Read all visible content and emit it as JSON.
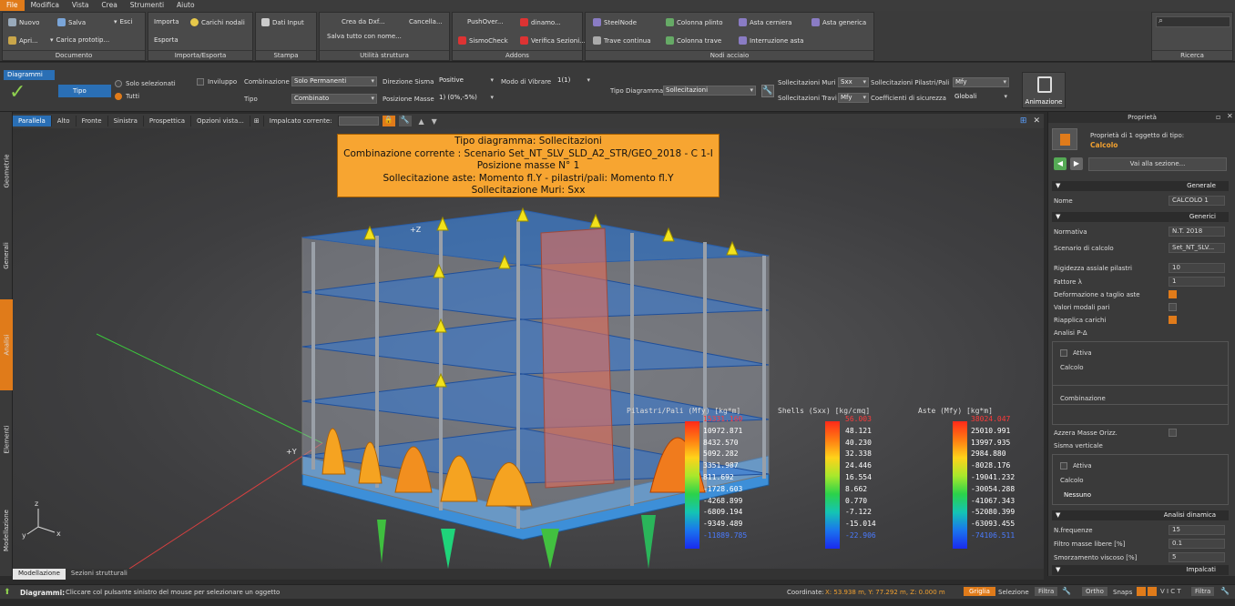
{
  "menu": [
    "File",
    "Modifica",
    "Vista",
    "Crea",
    "Strumenti",
    "Aiuto"
  ],
  "ribbon": {
    "documento": {
      "title": "Documento",
      "nuovo": "Nuovo",
      "salva": "Salva",
      "esci": "Esci",
      "apri": "Apri...",
      "carica": "Carica prototip..."
    },
    "importa": {
      "title": "Importa/Esporta",
      "importa": "Importa",
      "carichi": "Carichi nodali",
      "esporta": "Esporta"
    },
    "stampa": {
      "title": "Stampa",
      "dati": "Dati Input"
    },
    "utilita": {
      "title": "Utilità struttura",
      "crea": "Crea da Dxf...",
      "cancella": "Cancella...",
      "salva_nome": "Salva tutto con nome..."
    },
    "addons": {
      "title": "Addons",
      "pushover": "PushOver...",
      "dinamo": "dinamo...",
      "sismocheck": "SismoCheck",
      "verifica": "Verifica Sezioni..."
    },
    "nodi": {
      "title": "Nodi acciaio",
      "steelnode": "SteelNode",
      "colonna_plinto": "Colonna plinto",
      "asta_cerniera": "Asta cerniera",
      "asta_generica": "Asta generica",
      "trave_continua": "Trave continua",
      "colonna_trave": "Colonna trave",
      "interruzione": "Interruzione asta"
    },
    "ricerca": {
      "title": "Ricerca"
    }
  },
  "toolbar2": {
    "diagrammi": "Diagrammi",
    "tipo": "Tipo",
    "solo_sel": "Solo selezionati",
    "tutti": "Tutti",
    "inviluppo": "Inviluppo",
    "combinazione_label": "Combinazione",
    "combinazione_val": "Solo Permanenti",
    "tipo_label": "Tipo",
    "tipo_val": "Combinato",
    "dir_sisma_label": "Direzione Sisma",
    "dir_sisma_val": "Positive",
    "pos_masse_label": "Posizione Masse",
    "pos_masse_val": "1) (0%,-5%)",
    "modo_label": "Modo di Vibrare",
    "modo_val": "1(1)",
    "tipo_diag_label": "Tipo Diagramma",
    "tipo_diag_val": "Sollecitazioni",
    "soll_muri_label": "Sollecitazioni Muri",
    "soll_muri_val": "Sxx",
    "soll_pilastri_label": "Sollecitazioni Pilastri/Pali",
    "soll_pilastri_val": "Mfy",
    "soll_travi_label": "Sollecitazioni Travi",
    "soll_travi_val": "Mfy",
    "coeff_label": "Coefficienti di sicurezza",
    "coeff_val": "Globali",
    "animazione": "Animazione"
  },
  "viewtabs": [
    "Parallela",
    "Alto",
    "Fronte",
    "Sinistra",
    "Prospettica"
  ],
  "opzioni_vista": "Opzioni vista...",
  "impalcato_label": "Impalcato corrente:",
  "lefttabs": [
    "Geometrie",
    "Generali",
    "Analisi",
    "Elementi",
    "Modellazione"
  ],
  "banner": [
    "Tipo diagramma: Sollecitazioni",
    "Combinazione corrente : Scenario Set_NT_SLV_SLD_A2_STR/GEO_2018 - C 1-I",
    "Posizione masse N° 1",
    "Sollecitazione aste: Momento fl.Y - pilastri/pali: Momento fl.Y",
    "Sollecitazione Muri: Sxx"
  ],
  "legends": [
    {
      "title": "Pilastri/Pali (Mfy) [kg*m]",
      "values": [
        "15331.160",
        "10972.871",
        "8432.570",
        "5092.282",
        "3351.987",
        "811.692",
        "-1728.603",
        "-4268.899",
        "-6809.194",
        "-9349.489",
        "-11889.785"
      ]
    },
    {
      "title": "Shells (Sxx) [kg/cmq]",
      "values": [
        "56.003",
        "48.121",
        "40.230",
        "32.338",
        "24.446",
        "16.554",
        "8.662",
        "0.770",
        "-7.122",
        "-15.014",
        "-22.906"
      ]
    },
    {
      "title": "Aste (Mfy) [kg*m]",
      "values": [
        "38024.047",
        "25010.991",
        "13997.935",
        "2984.880",
        "-8028.176",
        "-19041.232",
        "-30054.288",
        "-41067.343",
        "-52080.399",
        "-63093.455",
        "-74106.511"
      ]
    }
  ],
  "axis": {
    "z": "+Z",
    "y": "+Y"
  },
  "bottomtabs": [
    "Modellazione",
    "Sezioni strutturali"
  ],
  "panel": {
    "title": "Proprietà",
    "header1": "Proprietà di 1 oggetto di tipo:",
    "header2": "Calcolo",
    "goto": "Vai alla sezione...",
    "sec_generale": "Generale",
    "nome_label": "Nome",
    "nome_val": "CALCOLO 1",
    "sec_generici": "Generici",
    "normativa_label": "Normativa",
    "normativa_val": "N.T. 2018",
    "scenario_label": "Scenario di calcolo",
    "scenario_val": "Set_NT_SLV...",
    "rigidezza_label": "Rigidezza assiale pilastri",
    "rigidezza_val": "10",
    "fattore_label": "Fattore λ",
    "fattore_val": "1",
    "deform_label": "Deformazione a taglio aste",
    "valori_label": "Valori modali pari",
    "riapplica_label": "Riapplica carichi",
    "analisi_pd": "Analisi P-Δ",
    "attiva1": "Attiva",
    "calcolo1": "Calcolo",
    "combinazione": "Combinazione",
    "azzera": "Azzera Masse Orizz.",
    "sisma_vert": "Sisma verticale",
    "attiva2": "Attiva",
    "calcolo2": "Calcolo",
    "nessuno": "Nessuno",
    "sec_dinamica": "Analisi dinamica",
    "nfreq_label": "N.frequenze",
    "nfreq_val": "15",
    "filtro_label": "Filtro masse libere [%]",
    "filtro_val": "0.1",
    "smorz_label": "Smorzamento viscoso [%]",
    "smorz_val": "5",
    "sec_impalcati": "Impalcati"
  },
  "status": {
    "mode": "Diagrammi:",
    "hint": "Cliccare col pulsante sinistro del mouse per selezionare un oggetto",
    "coord_label": "Coordinate:",
    "coord_val": "X: 53.938 m, Y: 77.292 m, Z: 0.000 m",
    "griglia": "Griglia",
    "selezione": "Selezione",
    "filtra": "Filtra",
    "ortho": "Ortho",
    "snaps": "Snaps",
    "filtra2": "Filtra"
  },
  "colors": {
    "accent": "#e07b1a",
    "selected_tab": "#2a6fb5",
    "banner": "#f7a531"
  }
}
